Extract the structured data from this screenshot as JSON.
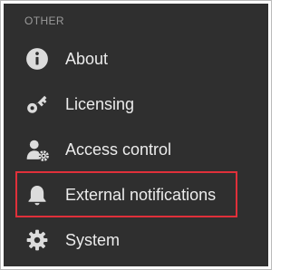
{
  "section": {
    "label": "OTHER"
  },
  "menu": {
    "items": [
      {
        "label": "About",
        "icon": "info-circle-icon"
      },
      {
        "label": "Licensing",
        "icon": "key-icon"
      },
      {
        "label": "Access control",
        "icon": "user-gear-icon"
      },
      {
        "label": "External notifications",
        "icon": "bell-icon"
      },
      {
        "label": "System",
        "icon": "gear-icon"
      }
    ]
  },
  "colors": {
    "panel_background": "#2f2f2f",
    "icon": "#dcdcdc",
    "text": "#ececec",
    "section_label": "#9a9a9a",
    "highlight_border": "#e0303a"
  }
}
